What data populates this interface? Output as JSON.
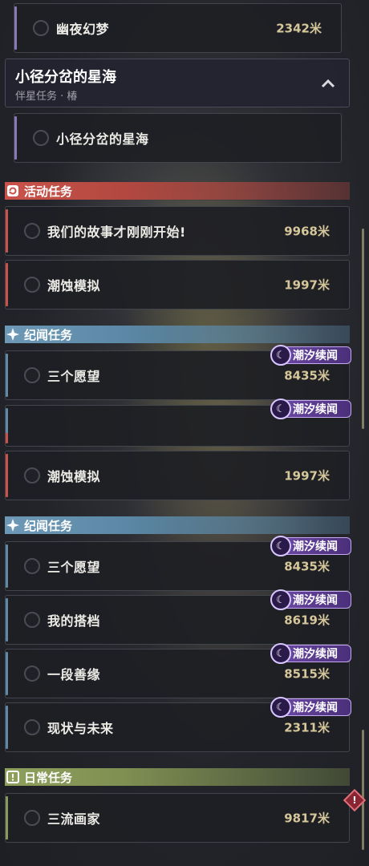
{
  "top_panel": {
    "item_fantasy": {
      "title": "幽夜幻梦",
      "distance": "2342米"
    },
    "companion_header": {
      "title": "小径分岔的星海",
      "subtitle": "伴星任务 · 椿"
    },
    "companion_item": {
      "title": "小径分岔的星海"
    },
    "section_event": {
      "label": "活动任务",
      "icon": "refresh-icon"
    },
    "event_items": [
      {
        "title": "我们的故事才刚刚开始!",
        "distance": "9968米"
      },
      {
        "title": "潮蚀模拟",
        "distance": "1997米"
      }
    ],
    "section_story": {
      "label": "纪闻任务",
      "icon": "star-icon"
    },
    "story_items": [
      {
        "title": "三个愿望",
        "distance": "8435米",
        "badge": "潮汐续闻"
      },
      {
        "title": "",
        "distance": "",
        "badge": "潮汐续闻"
      }
    ]
  },
  "bottom_panel": {
    "event_items": [
      {
        "title": "潮蚀模拟",
        "distance": "1997米"
      }
    ],
    "section_story": {
      "label": "纪闻任务",
      "icon": "star-icon"
    },
    "story_items": [
      {
        "title": "三个愿望",
        "distance": "8435米",
        "badge": "潮汐续闻"
      },
      {
        "title": "我的搭档",
        "distance": "8619米",
        "badge": "潮汐续闻"
      },
      {
        "title": "一段善缘",
        "distance": "8515米",
        "badge": "潮汐续闻"
      },
      {
        "title": "现状与未来",
        "distance": "2311米",
        "badge": "潮汐续闻"
      }
    ],
    "section_daily": {
      "label": "日常任务",
      "icon": "alert-icon"
    },
    "daily_items": [
      {
        "title": "三流画家",
        "distance": "9817米"
      }
    ]
  },
  "colors": {
    "event": "#c9534a",
    "story": "#5e8aa6",
    "daily": "#8a9a5a",
    "badge": "#6d4aa6",
    "distance": "#d6c79b"
  }
}
